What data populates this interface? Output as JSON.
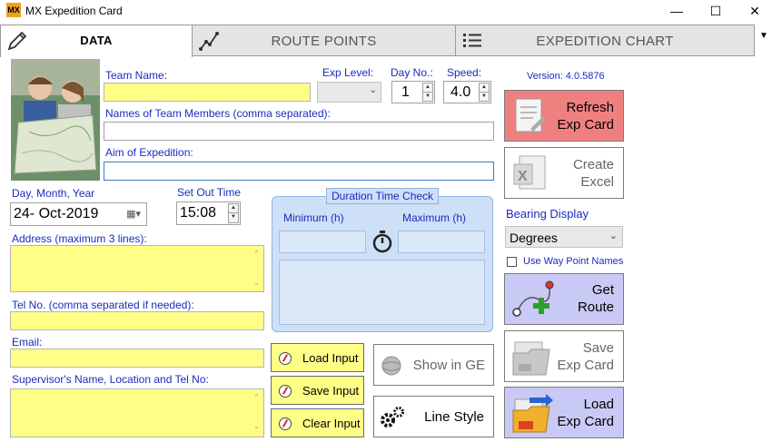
{
  "window": {
    "app_icon_text": "MX",
    "title": "MX Expedition Card",
    "minimize": "—",
    "maximize": "☐",
    "close": "✕"
  },
  "tabs": [
    {
      "label": "DATA",
      "active": true,
      "icon": "pencil-icon"
    },
    {
      "label": "ROUTE POINTS",
      "active": false,
      "icon": "route-icon"
    },
    {
      "label": "EXPEDITION CHART",
      "active": false,
      "icon": "list-icon"
    }
  ],
  "tab_overflow": "▼",
  "form": {
    "team_name_label": "Team Name:",
    "team_name_value": "",
    "exp_level_label": "Exp Level:",
    "exp_level_value": "",
    "day_no_label": "Day No.:",
    "day_no_value": "1",
    "speed_label": "Speed:",
    "speed_value": "4.0",
    "members_label": "Names of Team Members (comma separated):",
    "members_value": "",
    "aim_label": "Aim of Expedition:",
    "aim_value": "",
    "date_label": "Day, Month, Year",
    "date_value": "24- Oct-2019",
    "setout_label": "Set Out Time",
    "setout_value": "15:08",
    "address_label": "Address (maximum 3 lines):",
    "address_value": "",
    "tel_label": "Tel No. (comma separated if needed):",
    "tel_value": "",
    "email_label": "Email:",
    "email_value": "",
    "supervisor_label": "Supervisor's Name, Location and Tel No:",
    "supervisor_value": ""
  },
  "duration": {
    "legend": "Duration Time Check",
    "min_label": "Minimum (h)",
    "max_label": "Maximum (h)",
    "min_value": "",
    "max_value": ""
  },
  "buttons": {
    "load_input": "Load Input",
    "save_input": "Save Input",
    "clear_input": "Clear Input",
    "show_ge": "Show in GE",
    "line_style": "Line Style",
    "refresh_line1": "Refresh",
    "refresh_line2": "Exp Card",
    "excel_line1": "Create",
    "excel_line2": "Excel",
    "route_line1": "Get",
    "route_line2": "Route",
    "save_card_line1": "Save",
    "save_card_line2": "Exp Card",
    "load_card_line1": "Load",
    "load_card_line2": "Exp Card"
  },
  "right_panel": {
    "version": "Version: 4.0.5876",
    "bearing_label": "Bearing Display",
    "bearing_value": "Degrees",
    "waypoint_label": "Use Way Point Names",
    "waypoint_checked": false
  },
  "colors": {
    "label_blue": "#1a2bbf",
    "input_yellow": "#ffff88",
    "refresh_red": "#f08080",
    "route_purple": "#c9c9f5",
    "duration_blue": "#cde0f7"
  }
}
